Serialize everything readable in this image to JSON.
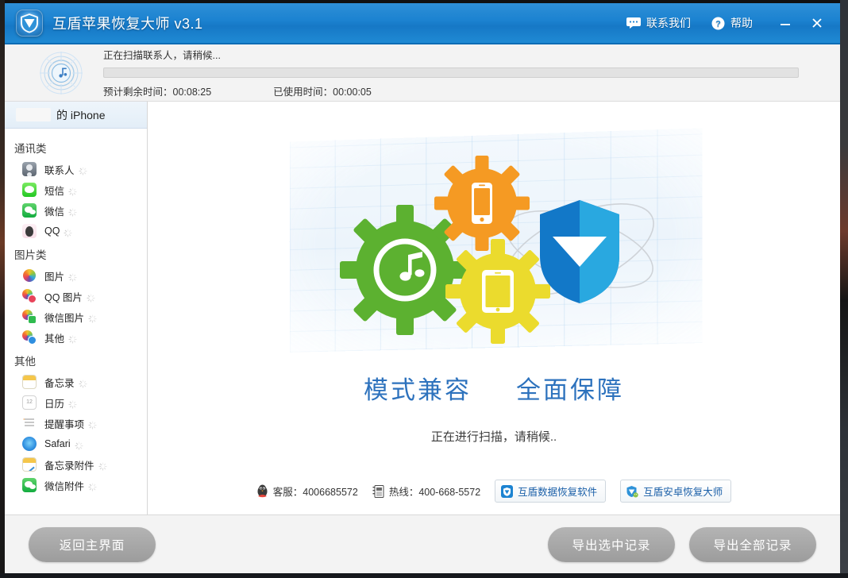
{
  "window": {
    "app_title": "互盾苹果恢复大师 v3.1",
    "logo_icon": "shield-logo-icon",
    "accent_color": "#1c83d1",
    "actions": [
      {
        "label": "联系我们",
        "icon": "chat-bubble-icon",
        "name": "contact-us"
      },
      {
        "label": "帮助",
        "icon": "question-circle-icon",
        "name": "help"
      }
    ],
    "minimize_icon": "minimize-icon",
    "close_icon": "close-icon"
  },
  "progress": {
    "scan_icon": "radar-music-scan-icon",
    "status_text": "正在扫描联系人，请稍候...",
    "percent": 0,
    "remaining_label": "预计剩余时间：00:08:25",
    "elapsed_label": "已使用时间：00:00:05"
  },
  "sidebar": {
    "device": {
      "name": "的 iPhone",
      "redacted": true
    },
    "groups": [
      {
        "title": "通讯类",
        "items": [
          {
            "label": "联系人",
            "icon": "contacts-icon",
            "icon_class": "ic-contacts",
            "loading": true
          },
          {
            "label": "短信",
            "icon": "sms-icon",
            "icon_class": "ic-sms",
            "loading": true
          },
          {
            "label": "微信",
            "icon": "wechat-icon",
            "icon_class": "ic-wechat",
            "loading": true
          },
          {
            "label": "QQ",
            "icon": "qq-icon",
            "icon_class": "ic-qq",
            "loading": true
          }
        ]
      },
      {
        "title": "图片类",
        "items": [
          {
            "label": "图片",
            "icon": "photos-icon",
            "icon_class": "ic-photos",
            "loading": true
          },
          {
            "label": "QQ 图片",
            "icon": "qq-photos-icon",
            "icon_class": "ic-qqpic",
            "loading": true
          },
          {
            "label": "微信图片",
            "icon": "wechat-photos-icon",
            "icon_class": "ic-wxpic",
            "loading": true
          },
          {
            "label": "其他",
            "icon": "other-photos-icon",
            "icon_class": "ic-otherpic",
            "loading": true
          }
        ]
      },
      {
        "title": "其他",
        "items": [
          {
            "label": "备忘录",
            "icon": "notes-icon",
            "icon_class": "ic-notes",
            "loading": true
          },
          {
            "label": "日历",
            "icon": "calendar-icon",
            "icon_class": "ic-calendar",
            "loading": true
          },
          {
            "label": "提醒事项",
            "icon": "reminders-icon",
            "icon_class": "ic-reminders",
            "loading": true
          },
          {
            "label": "Safari",
            "icon": "safari-icon",
            "icon_class": "ic-safari",
            "loading": true
          },
          {
            "label": "备忘录附件",
            "icon": "notes-attachment-icon",
            "icon_class": "ic-notesatt",
            "loading": true
          },
          {
            "label": "微信附件",
            "icon": "wechat-attachment-icon",
            "icon_class": "ic-wxatt",
            "loading": true
          }
        ]
      }
    ]
  },
  "main": {
    "illustration": {
      "name": "gears-shield-illustration",
      "colors": {
        "gear_green": "#5cb130",
        "gear_orange": "#f59a23",
        "gear_yellow": "#ebdb2d",
        "shield_light": "#29a8e0",
        "shield_dark": "#1278c8",
        "grid": "#d7e8f6"
      }
    },
    "tagline": [
      "模式兼容",
      "全面保障"
    ],
    "tagline_color": "#2d72bd",
    "status_line": "正在进行扫描，请稍候..",
    "contacts": [
      {
        "name": "qq-service",
        "icon": "qq-penguin-icon",
        "label": "客服：4006685572"
      },
      {
        "name": "hotline",
        "icon": "phone-book-icon",
        "label": "热线：400-668-5572"
      }
    ],
    "promos": [
      {
        "name": "huduan-data-recovery",
        "icon": "shield-blue-icon",
        "label": "互盾数据恢复软件"
      },
      {
        "name": "huduan-android-recovery",
        "icon": "shield-android-icon",
        "label": "互盾安卓恢复大师"
      }
    ]
  },
  "footer": {
    "back_label": "返回主界面",
    "export_selected_label": "导出选中记录",
    "export_all_label": "导出全部记录"
  }
}
